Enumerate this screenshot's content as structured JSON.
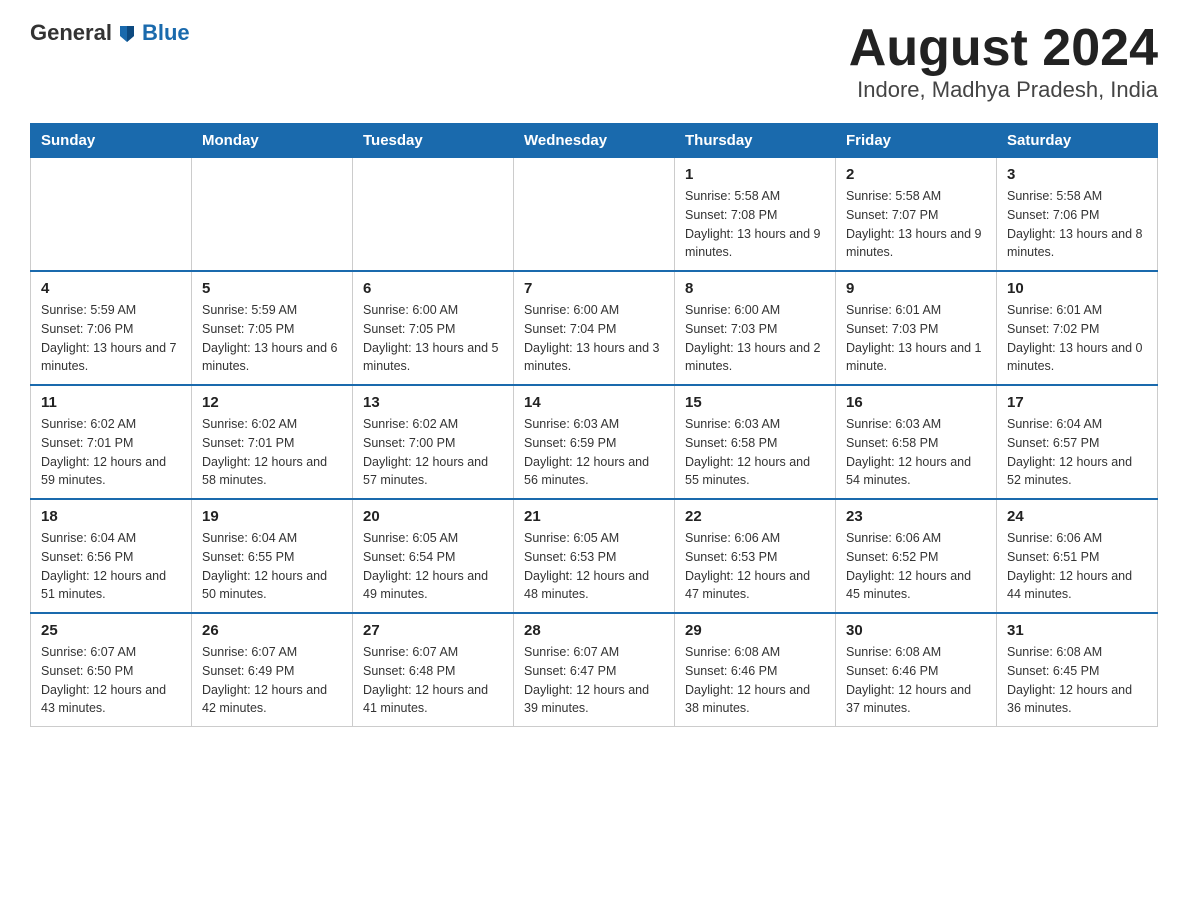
{
  "header": {
    "logo_general": "General",
    "logo_blue": "Blue",
    "title": "August 2024",
    "subtitle": "Indore, Madhya Pradesh, India"
  },
  "days_of_week": [
    "Sunday",
    "Monday",
    "Tuesday",
    "Wednesday",
    "Thursday",
    "Friday",
    "Saturday"
  ],
  "weeks": [
    [
      {
        "day": "",
        "sunrise": "",
        "sunset": "",
        "daylight": ""
      },
      {
        "day": "",
        "sunrise": "",
        "sunset": "",
        "daylight": ""
      },
      {
        "day": "",
        "sunrise": "",
        "sunset": "",
        "daylight": ""
      },
      {
        "day": "",
        "sunrise": "",
        "sunset": "",
        "daylight": ""
      },
      {
        "day": "1",
        "sunrise": "Sunrise: 5:58 AM",
        "sunset": "Sunset: 7:08 PM",
        "daylight": "Daylight: 13 hours and 9 minutes."
      },
      {
        "day": "2",
        "sunrise": "Sunrise: 5:58 AM",
        "sunset": "Sunset: 7:07 PM",
        "daylight": "Daylight: 13 hours and 9 minutes."
      },
      {
        "day": "3",
        "sunrise": "Sunrise: 5:58 AM",
        "sunset": "Sunset: 7:06 PM",
        "daylight": "Daylight: 13 hours and 8 minutes."
      }
    ],
    [
      {
        "day": "4",
        "sunrise": "Sunrise: 5:59 AM",
        "sunset": "Sunset: 7:06 PM",
        "daylight": "Daylight: 13 hours and 7 minutes."
      },
      {
        "day": "5",
        "sunrise": "Sunrise: 5:59 AM",
        "sunset": "Sunset: 7:05 PM",
        "daylight": "Daylight: 13 hours and 6 minutes."
      },
      {
        "day": "6",
        "sunrise": "Sunrise: 6:00 AM",
        "sunset": "Sunset: 7:05 PM",
        "daylight": "Daylight: 13 hours and 5 minutes."
      },
      {
        "day": "7",
        "sunrise": "Sunrise: 6:00 AM",
        "sunset": "Sunset: 7:04 PM",
        "daylight": "Daylight: 13 hours and 3 minutes."
      },
      {
        "day": "8",
        "sunrise": "Sunrise: 6:00 AM",
        "sunset": "Sunset: 7:03 PM",
        "daylight": "Daylight: 13 hours and 2 minutes."
      },
      {
        "day": "9",
        "sunrise": "Sunrise: 6:01 AM",
        "sunset": "Sunset: 7:03 PM",
        "daylight": "Daylight: 13 hours and 1 minute."
      },
      {
        "day": "10",
        "sunrise": "Sunrise: 6:01 AM",
        "sunset": "Sunset: 7:02 PM",
        "daylight": "Daylight: 13 hours and 0 minutes."
      }
    ],
    [
      {
        "day": "11",
        "sunrise": "Sunrise: 6:02 AM",
        "sunset": "Sunset: 7:01 PM",
        "daylight": "Daylight: 12 hours and 59 minutes."
      },
      {
        "day": "12",
        "sunrise": "Sunrise: 6:02 AM",
        "sunset": "Sunset: 7:01 PM",
        "daylight": "Daylight: 12 hours and 58 minutes."
      },
      {
        "day": "13",
        "sunrise": "Sunrise: 6:02 AM",
        "sunset": "Sunset: 7:00 PM",
        "daylight": "Daylight: 12 hours and 57 minutes."
      },
      {
        "day": "14",
        "sunrise": "Sunrise: 6:03 AM",
        "sunset": "Sunset: 6:59 PM",
        "daylight": "Daylight: 12 hours and 56 minutes."
      },
      {
        "day": "15",
        "sunrise": "Sunrise: 6:03 AM",
        "sunset": "Sunset: 6:58 PM",
        "daylight": "Daylight: 12 hours and 55 minutes."
      },
      {
        "day": "16",
        "sunrise": "Sunrise: 6:03 AM",
        "sunset": "Sunset: 6:58 PM",
        "daylight": "Daylight: 12 hours and 54 minutes."
      },
      {
        "day": "17",
        "sunrise": "Sunrise: 6:04 AM",
        "sunset": "Sunset: 6:57 PM",
        "daylight": "Daylight: 12 hours and 52 minutes."
      }
    ],
    [
      {
        "day": "18",
        "sunrise": "Sunrise: 6:04 AM",
        "sunset": "Sunset: 6:56 PM",
        "daylight": "Daylight: 12 hours and 51 minutes."
      },
      {
        "day": "19",
        "sunrise": "Sunrise: 6:04 AM",
        "sunset": "Sunset: 6:55 PM",
        "daylight": "Daylight: 12 hours and 50 minutes."
      },
      {
        "day": "20",
        "sunrise": "Sunrise: 6:05 AM",
        "sunset": "Sunset: 6:54 PM",
        "daylight": "Daylight: 12 hours and 49 minutes."
      },
      {
        "day": "21",
        "sunrise": "Sunrise: 6:05 AM",
        "sunset": "Sunset: 6:53 PM",
        "daylight": "Daylight: 12 hours and 48 minutes."
      },
      {
        "day": "22",
        "sunrise": "Sunrise: 6:06 AM",
        "sunset": "Sunset: 6:53 PM",
        "daylight": "Daylight: 12 hours and 47 minutes."
      },
      {
        "day": "23",
        "sunrise": "Sunrise: 6:06 AM",
        "sunset": "Sunset: 6:52 PM",
        "daylight": "Daylight: 12 hours and 45 minutes."
      },
      {
        "day": "24",
        "sunrise": "Sunrise: 6:06 AM",
        "sunset": "Sunset: 6:51 PM",
        "daylight": "Daylight: 12 hours and 44 minutes."
      }
    ],
    [
      {
        "day": "25",
        "sunrise": "Sunrise: 6:07 AM",
        "sunset": "Sunset: 6:50 PM",
        "daylight": "Daylight: 12 hours and 43 minutes."
      },
      {
        "day": "26",
        "sunrise": "Sunrise: 6:07 AM",
        "sunset": "Sunset: 6:49 PM",
        "daylight": "Daylight: 12 hours and 42 minutes."
      },
      {
        "day": "27",
        "sunrise": "Sunrise: 6:07 AM",
        "sunset": "Sunset: 6:48 PM",
        "daylight": "Daylight: 12 hours and 41 minutes."
      },
      {
        "day": "28",
        "sunrise": "Sunrise: 6:07 AM",
        "sunset": "Sunset: 6:47 PM",
        "daylight": "Daylight: 12 hours and 39 minutes."
      },
      {
        "day": "29",
        "sunrise": "Sunrise: 6:08 AM",
        "sunset": "Sunset: 6:46 PM",
        "daylight": "Daylight: 12 hours and 38 minutes."
      },
      {
        "day": "30",
        "sunrise": "Sunrise: 6:08 AM",
        "sunset": "Sunset: 6:46 PM",
        "daylight": "Daylight: 12 hours and 37 minutes."
      },
      {
        "day": "31",
        "sunrise": "Sunrise: 6:08 AM",
        "sunset": "Sunset: 6:45 PM",
        "daylight": "Daylight: 12 hours and 36 minutes."
      }
    ]
  ]
}
